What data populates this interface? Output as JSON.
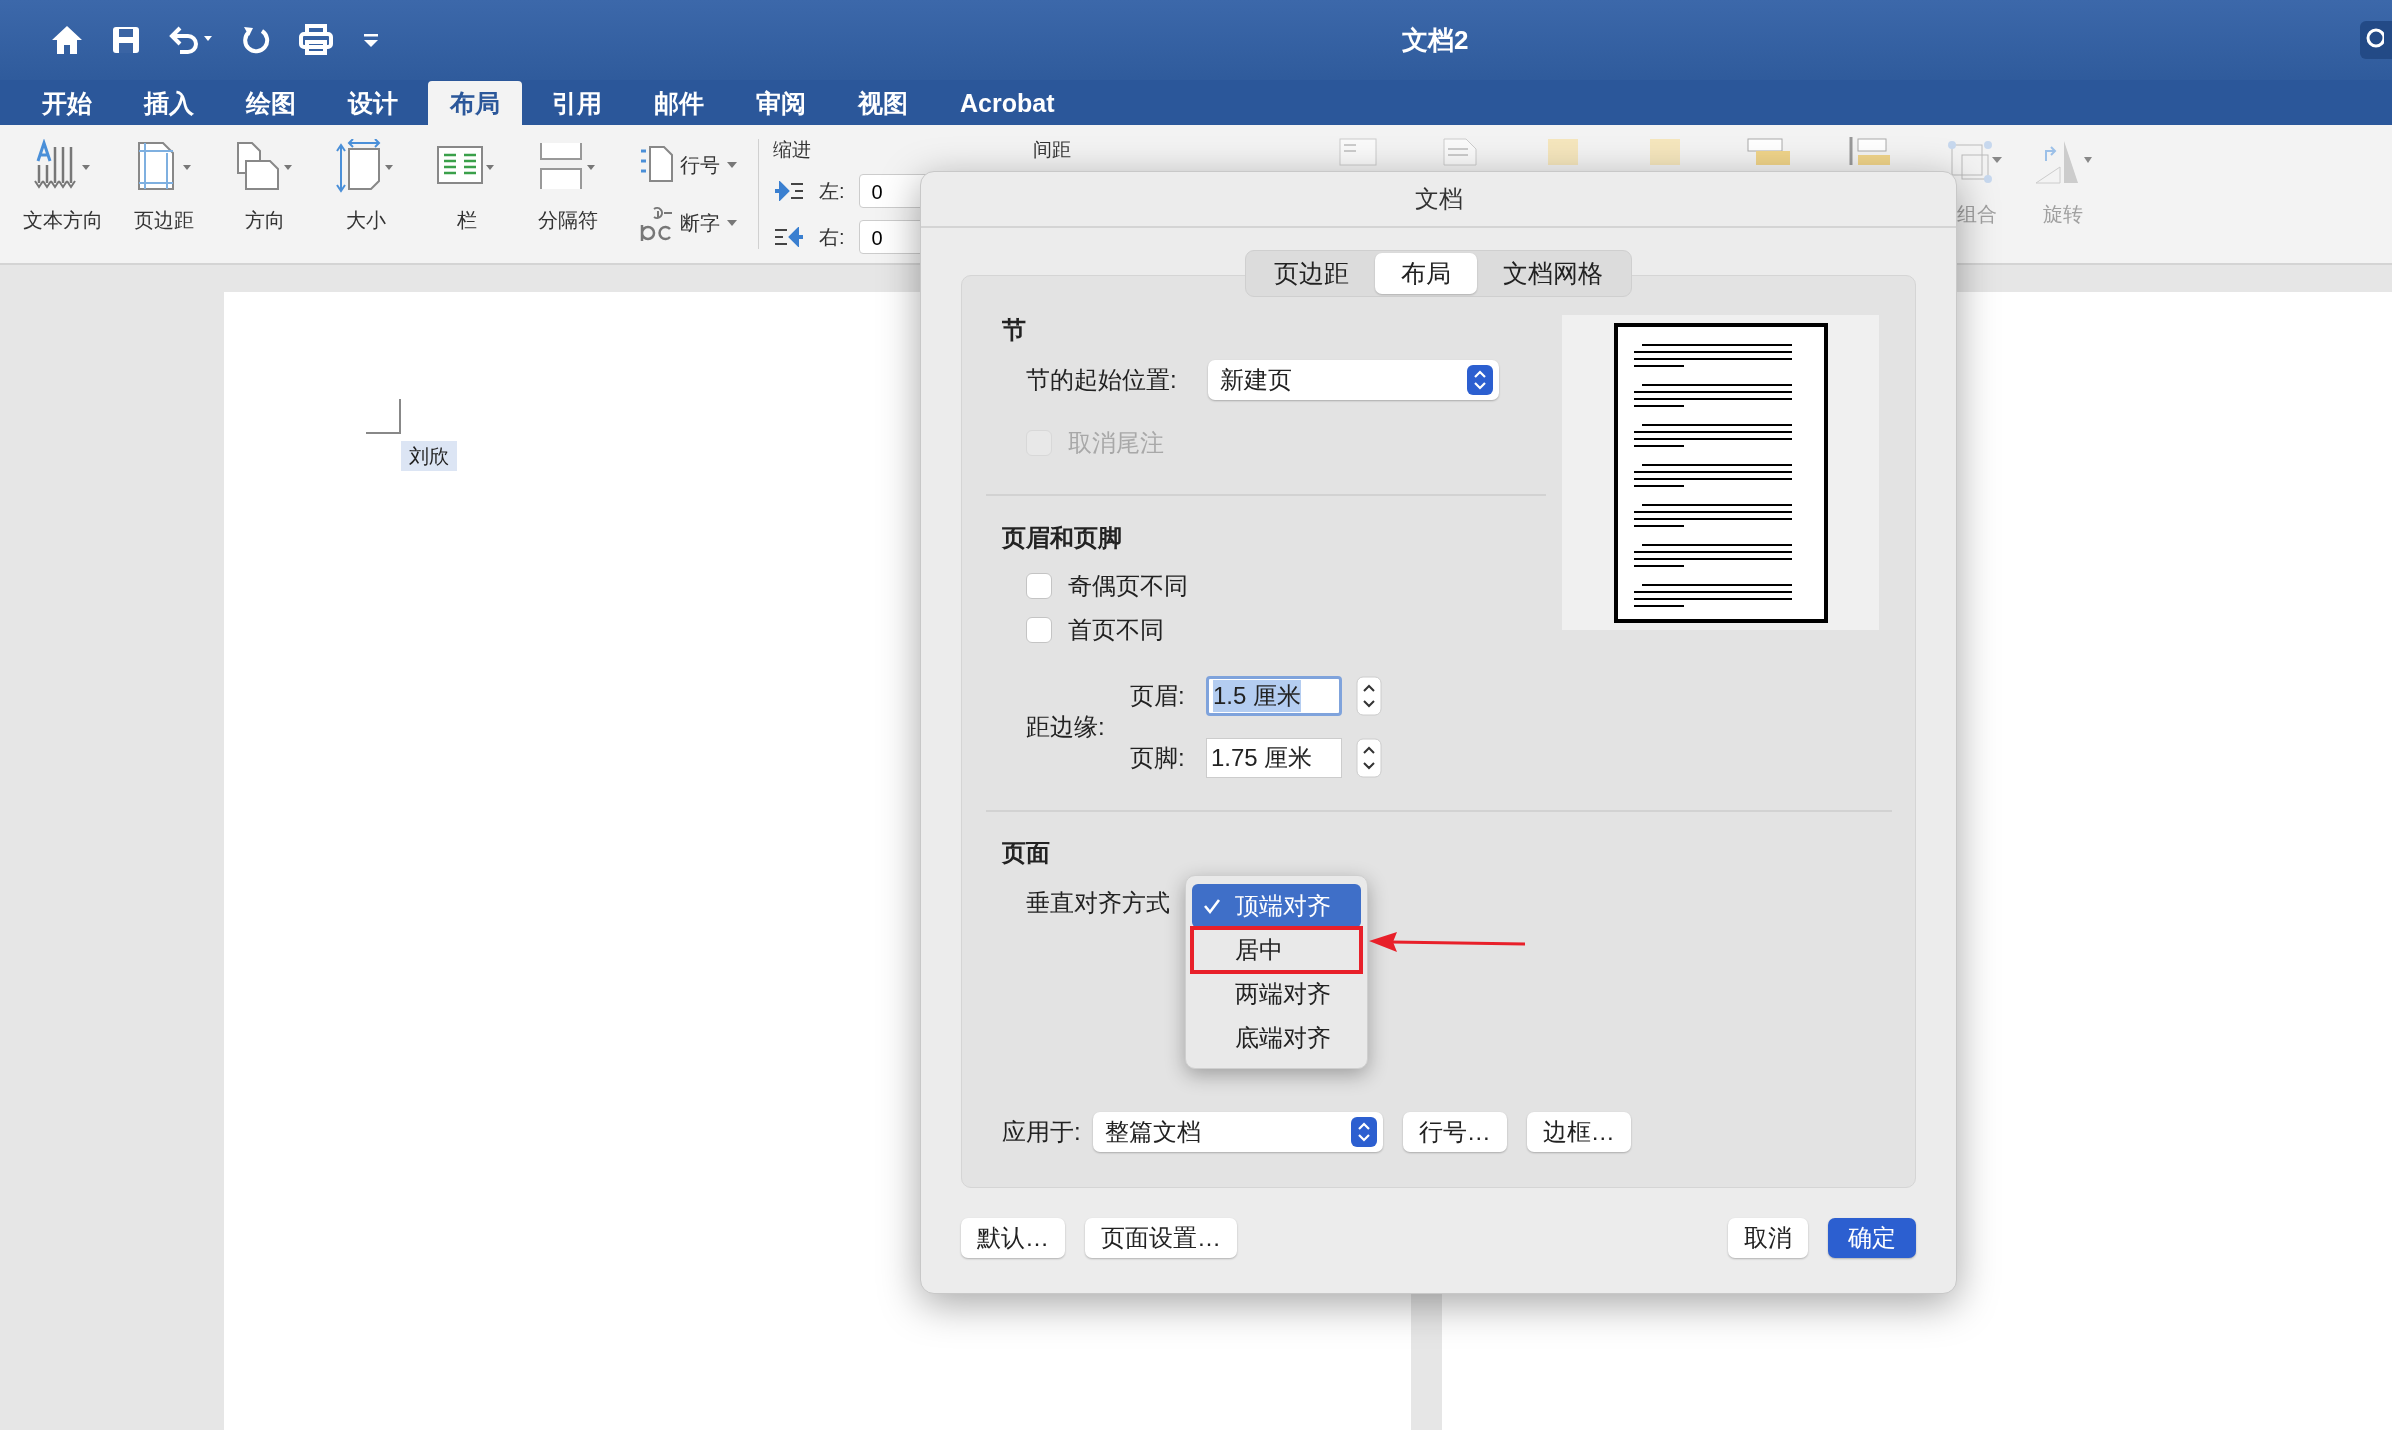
{
  "window": {
    "title": "文档2"
  },
  "ribbon_tabs": [
    {
      "label": "开始",
      "selected": false
    },
    {
      "label": "插入",
      "selected": false
    },
    {
      "label": "绘图",
      "selected": false
    },
    {
      "label": "设计",
      "selected": false
    },
    {
      "label": "布局",
      "selected": true
    },
    {
      "label": "引用",
      "selected": false
    },
    {
      "label": "邮件",
      "selected": false
    },
    {
      "label": "审阅",
      "selected": false
    },
    {
      "label": "视图",
      "selected": false
    },
    {
      "label": "Acrobat",
      "selected": false
    }
  ],
  "ribbon_buttons": [
    {
      "label": "文本方向",
      "kind": "text-direction"
    },
    {
      "label": "页边距",
      "kind": "margins"
    },
    {
      "label": "方向",
      "kind": "orientation"
    },
    {
      "label": "大小",
      "kind": "size"
    },
    {
      "label": "栏",
      "kind": "columns"
    },
    {
      "label": "分隔符",
      "kind": "breaks"
    }
  ],
  "ribbon_small_buttons": [
    {
      "label": "行号",
      "kind": "line-numbers"
    },
    {
      "label": "断字",
      "kind": "hyphenation"
    }
  ],
  "indent": {
    "title": "缩进",
    "rows": [
      {
        "label": "左:",
        "value": "0",
        "kind": "left"
      },
      {
        "label": "右:",
        "value": "0",
        "kind": "right"
      }
    ]
  },
  "spacing": {
    "title": "间距"
  },
  "arrange_buttons": [
    {
      "label": "组合",
      "kind": "group",
      "disabled": true
    },
    {
      "label": "旋转",
      "kind": "rotate",
      "disabled": true
    }
  ],
  "document": {
    "text": "刘欣"
  },
  "dialog": {
    "title": "文档",
    "tabs": [
      {
        "label": "页边距",
        "selected": false
      },
      {
        "label": "布局",
        "selected": true
      },
      {
        "label": "文档网格",
        "selected": false
      }
    ],
    "section": {
      "heading": "节",
      "start_label": "节的起始位置:",
      "start_value": "新建页",
      "endnote": {
        "label": "取消尾注",
        "checked": false,
        "disabled": true
      }
    },
    "header_footer": {
      "heading": "页眉和页脚",
      "options": [
        {
          "label": "奇偶页不同",
          "checked": false,
          "disabled": false
        },
        {
          "label": "首页不同",
          "checked": false,
          "disabled": false
        }
      ],
      "distance_label": "距边缘:",
      "fields": [
        {
          "label": "页眉:",
          "value": "1.5 厘米",
          "focused": true
        },
        {
          "label": "页脚:",
          "value": "1.75 厘米",
          "focused": false
        }
      ]
    },
    "page": {
      "heading": "页面",
      "valign_label": "垂直对齐方式",
      "valign_options": [
        {
          "label": "顶端对齐",
          "selected": true,
          "marked": false
        },
        {
          "label": "居中",
          "selected": false,
          "marked": true
        },
        {
          "label": "两端对齐",
          "selected": false,
          "marked": false
        },
        {
          "label": "底端对齐",
          "selected": false,
          "marked": false
        }
      ]
    },
    "apply": {
      "label": "应用于:",
      "value": "整篇文档",
      "buttons": [
        "行号…",
        "边框…"
      ]
    },
    "buttons": [
      {
        "label": "默认…",
        "kind": "aux"
      },
      {
        "label": "页面设置…",
        "kind": "aux"
      },
      {
        "label": "取消",
        "kind": "cancel"
      },
      {
        "label": "确定",
        "kind": "default"
      }
    ]
  }
}
